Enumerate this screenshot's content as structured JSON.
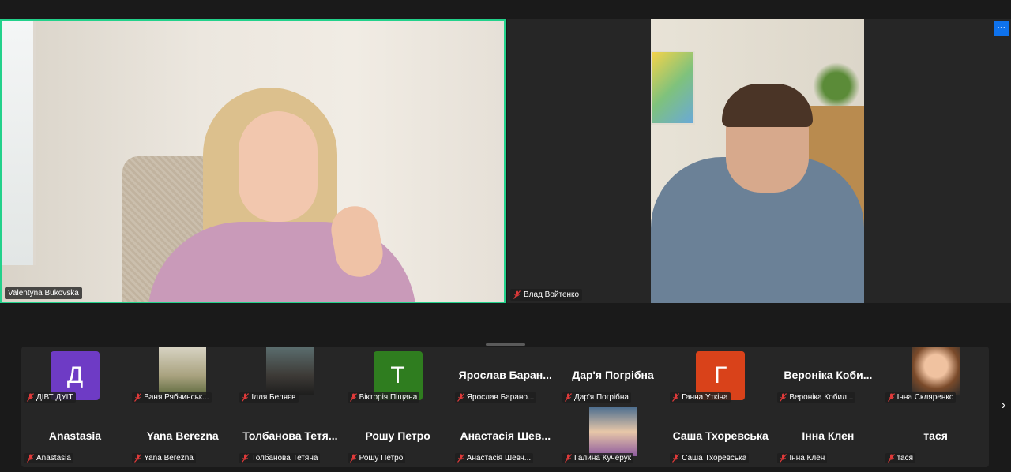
{
  "main_tiles": {
    "left": {
      "name": "Valentyna Bukovska"
    },
    "right": {
      "name": "Влад Войтенко",
      "more_label": "···"
    }
  },
  "colors": {
    "active_speaker": "#23d18b",
    "accent": "#0e72ed",
    "muted": "#e03a3a"
  },
  "participants": [
    {
      "display": "avatar",
      "initial": "Д",
      "color": "#6e3bc5",
      "name": "ДІВТ ДУІТ"
    },
    {
      "display": "photo",
      "name": "Ваня Рябчинськ..."
    },
    {
      "display": "photo",
      "name": "Ілля Беляєв"
    },
    {
      "display": "avatar",
      "initial": "Т",
      "color": "#2f7d1f",
      "name": "Вікторія Піщана"
    },
    {
      "display": "text",
      "big": "Ярослав  Баран...",
      "name": "Ярослав Барано..."
    },
    {
      "display": "text",
      "big": "Дар'я Погрібна",
      "name": "Дар'я Погрібна"
    },
    {
      "display": "avatar",
      "initial": "Г",
      "color": "#d9421a",
      "name": "Ганна Уткіна"
    },
    {
      "display": "text",
      "big": "Вероніка Коби...",
      "name": "Вероніка Кобил..."
    },
    {
      "display": "photo",
      "name": "Інна Скляренко"
    },
    {
      "display": "text",
      "big": "Anastasia",
      "name": "Anastasia"
    },
    {
      "display": "text",
      "big": "Yana Berezna",
      "name": "Yana Berezna"
    },
    {
      "display": "text",
      "big": "Толбанова  Тетя...",
      "name": "Толбанова Тетяна"
    },
    {
      "display": "text",
      "big": "Рошу Петро",
      "name": "Рошу Петро"
    },
    {
      "display": "text",
      "big": "Анастасія  Шев...",
      "name": "Анастасія Шевч..."
    },
    {
      "display": "photo",
      "name": "Галина Кучерук"
    },
    {
      "display": "text",
      "big": "Саша Тхоревська",
      "name": "Саша Тхоревська"
    },
    {
      "display": "text",
      "big": "Інна Клен",
      "name": "Інна Клен"
    },
    {
      "display": "text",
      "big": "тася",
      "name": "тася"
    }
  ],
  "next_page_label": "›"
}
